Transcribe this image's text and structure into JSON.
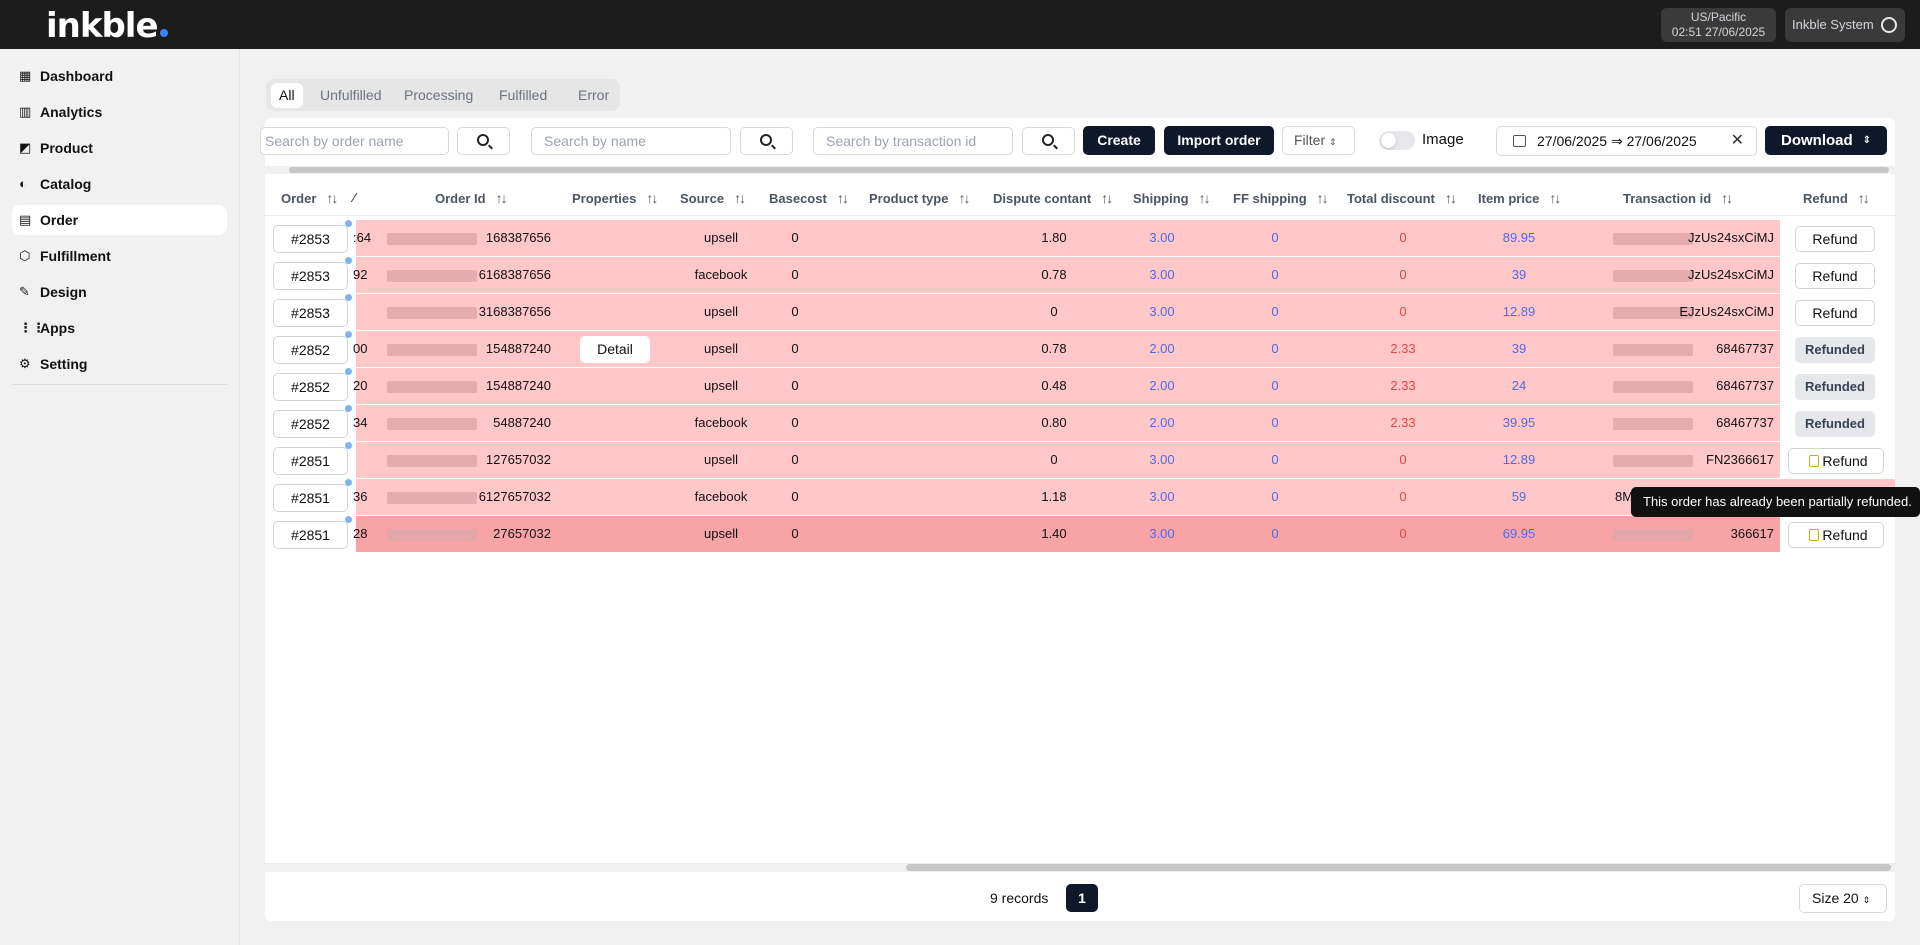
{
  "header": {
    "logo": "inkble",
    "timezone": "US/Pacific",
    "datetime": "02:51 27/06/2025",
    "user": "Inkble System"
  },
  "sidebar": {
    "items": [
      {
        "label": "Dashboard",
        "icon": "dashboard-icon"
      },
      {
        "label": "Analytics",
        "icon": "analytics-icon"
      },
      {
        "label": "Product",
        "icon": "product-icon"
      },
      {
        "label": "Catalog",
        "icon": "catalog-icon"
      },
      {
        "label": "Order",
        "icon": "order-icon",
        "active": true
      },
      {
        "label": "Fulfillment",
        "icon": "fulfillment-icon"
      },
      {
        "label": "Design",
        "icon": "design-icon"
      },
      {
        "label": "Apps",
        "icon": "apps-icon"
      },
      {
        "label": "Setting",
        "icon": "gear-icon"
      }
    ]
  },
  "tabs": [
    "All",
    "Unfulfilled",
    "Processing",
    "Fulfilled",
    "Error"
  ],
  "toolbar": {
    "search_order_placeholder": "Search by order name",
    "search_name_placeholder": "Search by name",
    "search_transaction_placeholder": "Search by transaction id",
    "create_label": "Create",
    "import_label": "Import order",
    "filter_label": "Filter",
    "image_toggle_label": "Image",
    "date_range": "27/06/2025 ⇒ 27/06/2025",
    "download_label": "Download"
  },
  "table": {
    "columns": [
      "Order",
      "Order Id",
      "Properties",
      "Source",
      "Basecost",
      "Product type",
      "Dispute contant",
      "Shipping",
      "FF shipping",
      "Total discount",
      "Item price",
      "Transaction id",
      "Refund"
    ],
    "rows": [
      {
        "order": "#2853",
        "frag": ":64",
        "order_id": "168387656",
        "properties": "",
        "source": "upsell",
        "basecost": "0",
        "product_type": "",
        "dispute": "1.80",
        "shipping": "3.00",
        "ff_shipping": "0",
        "discount": "0",
        "item_price": "89.95",
        "transaction_id": "JzUs24sxCiMJ",
        "refund": "Refund",
        "refund_state": "normal"
      },
      {
        "order": "#2853",
        "frag": "92",
        "order_id": "6168387656",
        "properties": "",
        "source": "facebook",
        "basecost": "0",
        "product_type": "",
        "dispute": "0.78",
        "shipping": "3.00",
        "ff_shipping": "0",
        "discount": "0",
        "item_price": "39",
        "transaction_id": "JzUs24sxCiMJ",
        "refund": "Refund",
        "refund_state": "normal"
      },
      {
        "order": "#2853",
        "frag": "",
        "order_id": "3168387656",
        "properties": "",
        "source": "upsell",
        "basecost": "0",
        "product_type": "",
        "dispute": "0",
        "shipping": "3.00",
        "ff_shipping": "0",
        "discount": "0",
        "item_price": "12.89",
        "transaction_id": "EJzUs24sxCiMJ",
        "refund": "Refund",
        "refund_state": "normal"
      },
      {
        "order": "#2852",
        "frag": "00",
        "order_id": "154887240",
        "properties": "Detail",
        "source": "upsell",
        "basecost": "0",
        "product_type": "",
        "dispute": "0.78",
        "shipping": "2.00",
        "ff_shipping": "0",
        "discount": "2.33",
        "item_price": "39",
        "transaction_id": "68467737",
        "refund": "Refunded",
        "refund_state": "done"
      },
      {
        "order": "#2852",
        "frag": "20",
        "order_id": "154887240",
        "properties": "",
        "source": "upsell",
        "basecost": "0",
        "product_type": "",
        "dispute": "0.48",
        "shipping": "2.00",
        "ff_shipping": "0",
        "discount": "2.33",
        "item_price": "24",
        "transaction_id": "68467737",
        "refund": "Refunded",
        "refund_state": "done"
      },
      {
        "order": "#2852",
        "frag": "34",
        "order_id": "54887240",
        "properties": "",
        "source": "facebook",
        "basecost": "0",
        "product_type": "",
        "dispute": "0.80",
        "shipping": "2.00",
        "ff_shipping": "0",
        "discount": "2.33",
        "item_price": "39.95",
        "transaction_id": "68467737",
        "refund": "Refunded",
        "refund_state": "done"
      },
      {
        "order": "#2851",
        "frag": "",
        "order_id": "127657032",
        "properties": "",
        "source": "upsell",
        "basecost": "0",
        "product_type": "",
        "dispute": "0",
        "shipping": "3.00",
        "ff_shipping": "0",
        "discount": "0",
        "item_price": "12.89",
        "transaction_id": "FN2366617",
        "refund": "Refund",
        "refund_state": "partial"
      },
      {
        "order": "#2851",
        "frag": "36",
        "order_id": "6127657032",
        "properties": "",
        "source": "facebook",
        "basecost": "0",
        "product_type": "",
        "dispute": "1.18",
        "shipping": "3.00",
        "ff_shipping": "0",
        "discount": "0",
        "item_price": "59",
        "transaction_id": "8M",
        "refund": "",
        "refund_state": "hidden"
      },
      {
        "order": "#2851",
        "frag": "28",
        "order_id": "27657032",
        "properties": "",
        "source": "upsell",
        "basecost": "0",
        "product_type": "",
        "dispute": "1.40",
        "shipping": "3.00",
        "ff_shipping": "0",
        "discount": "0",
        "item_price": "69.95",
        "transaction_id": "366617",
        "refund": "Refund",
        "refund_state": "partial"
      }
    ]
  },
  "tooltip": "This order has already been partially refunded.",
  "footer": {
    "records": "9 records",
    "page": "1",
    "size": "Size 20"
  },
  "colors": {
    "row_bg": "#ffc7c8",
    "row_highlight": "#f8a3a6",
    "link_blue": "#4f6be5",
    "discount_red": "#e04747",
    "primary_dark": "#0f172a"
  }
}
